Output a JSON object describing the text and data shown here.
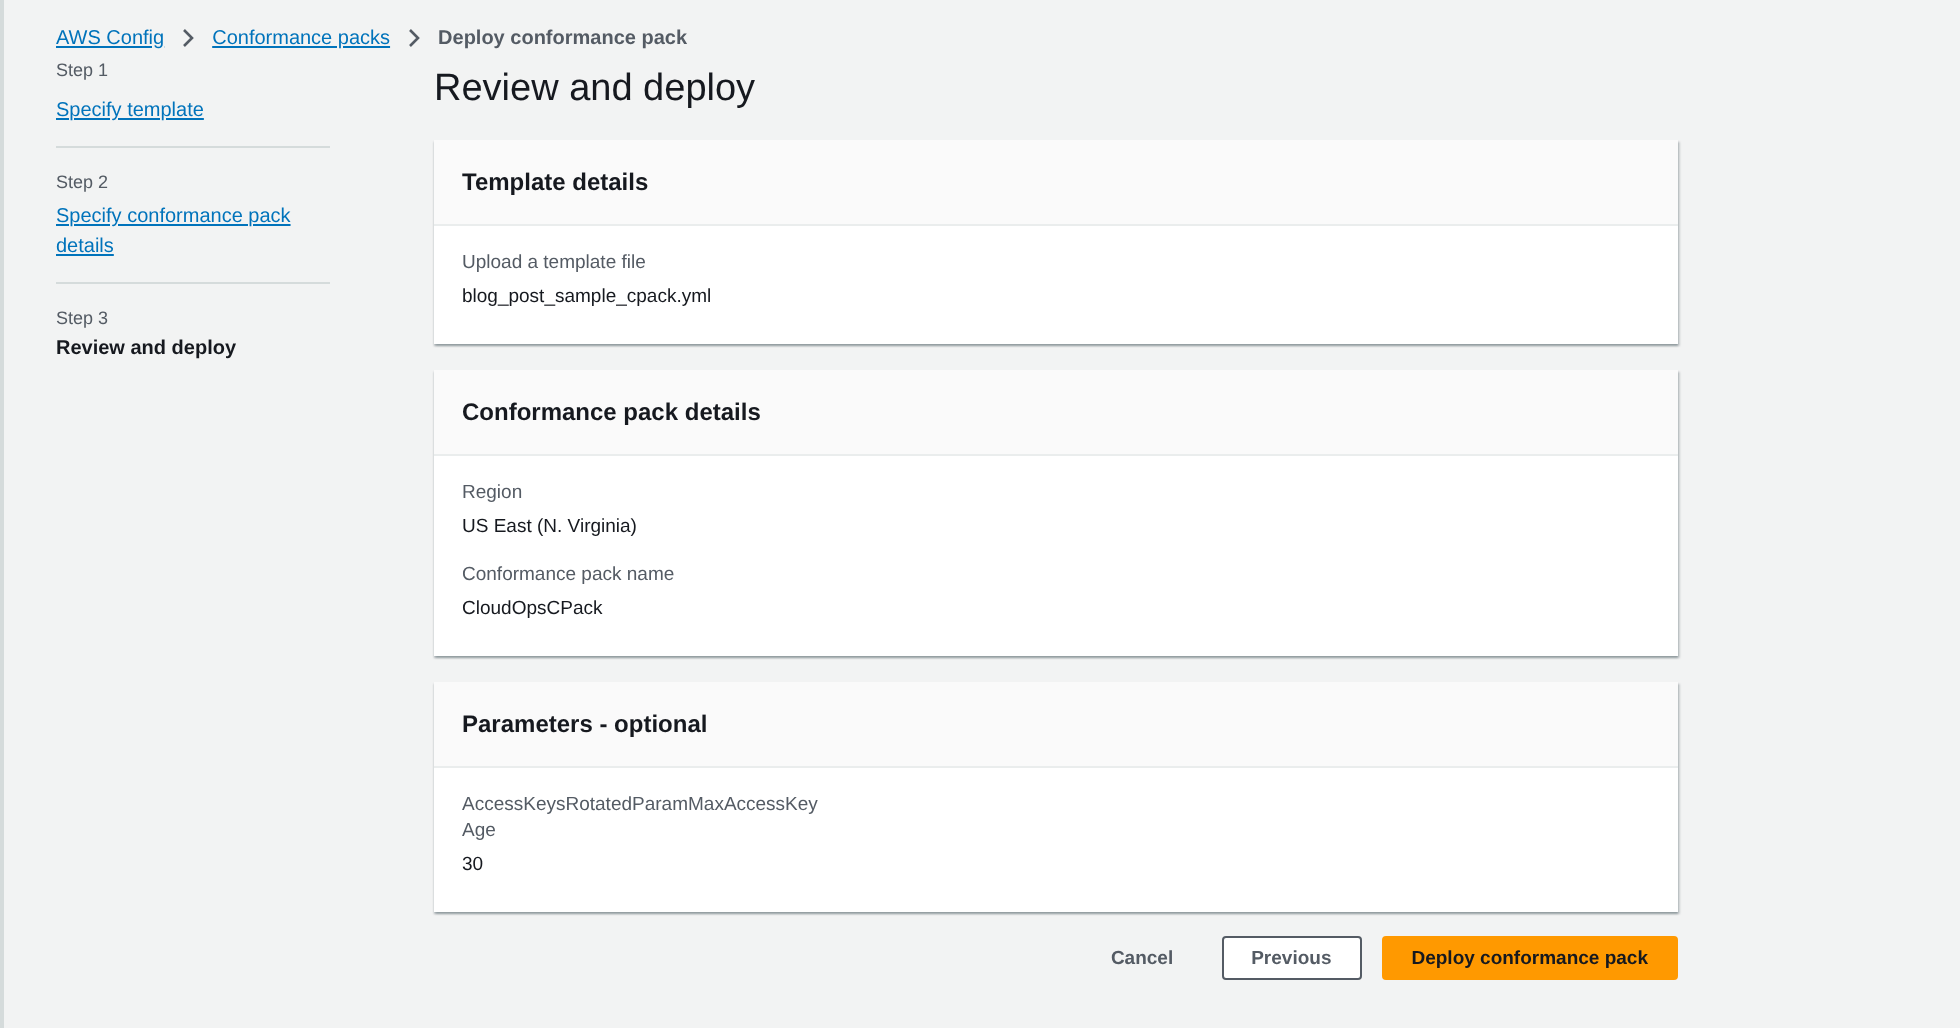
{
  "breadcrumbs": [
    {
      "label": "AWS Config",
      "link": true
    },
    {
      "label": "Conformance packs",
      "link": true
    },
    {
      "label": "Deploy conformance pack",
      "link": false
    }
  ],
  "steps": [
    {
      "step": "Step 1",
      "title": "Specify template",
      "selected": false
    },
    {
      "step": "Step 2",
      "title": "Specify conformance pack details",
      "selected": false
    },
    {
      "step": "Step 3",
      "title": "Review and deploy",
      "selected": true
    }
  ],
  "page_title": "Review and deploy",
  "panels": [
    {
      "title": "Template details",
      "fields": [
        {
          "label": "Upload a template file",
          "value": "blog_post_sample_cpack.yml"
        }
      ]
    },
    {
      "title": "Conformance pack details",
      "fields": [
        {
          "label": "Region",
          "value": "US East (N. Virginia)"
        },
        {
          "label": "Conformance pack name",
          "value": "CloudOpsCPack"
        }
      ]
    },
    {
      "title": "Parameters - optional",
      "fields": [
        {
          "label": "AccessKeysRotatedParamMaxAccessKeyAge",
          "value": "30"
        }
      ]
    }
  ],
  "actions": [
    {
      "label": "Cancel",
      "kind": "link"
    },
    {
      "label": "Previous",
      "kind": "normal"
    },
    {
      "label": "Deploy conformance pack",
      "kind": "primary"
    }
  ]
}
